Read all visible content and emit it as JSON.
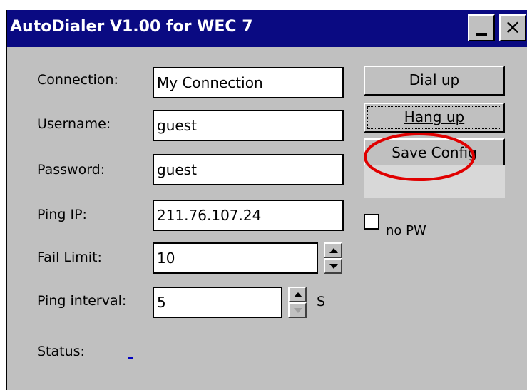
{
  "window": {
    "title": "AutoDialer V1.00 for WEC 7",
    "minimize_label": "_",
    "close_label": "×"
  },
  "form": {
    "connection": {
      "label": "Connection:",
      "value": "My Connection"
    },
    "username": {
      "label": "Username:",
      "value": "guest"
    },
    "password": {
      "label": "Password:",
      "value": "guest"
    },
    "ping_ip": {
      "label": "Ping IP:",
      "value": "211.76.107.24"
    },
    "fail_limit": {
      "label": "Fail Limit:",
      "value": "10"
    },
    "ping_interval": {
      "label": "Ping interval:",
      "value": "5",
      "unit": "S"
    },
    "status": {
      "label": "Status:",
      "value": ""
    }
  },
  "buttons": {
    "dial_up": "Dial up",
    "hang_up": "Hang up",
    "save_config": "Save Config"
  },
  "no_pw": {
    "label": "no PW",
    "checked": false
  },
  "colors": {
    "titlebar": "#0a0a82",
    "window_bg": "#c0c0c0",
    "highlight_circle": "#e00000"
  }
}
